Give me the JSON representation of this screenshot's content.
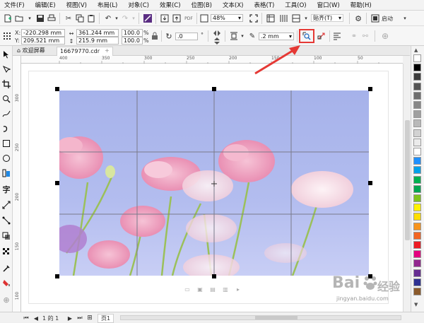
{
  "menu": [
    "文件(F)",
    "编辑(E)",
    "视图(V)",
    "布局(L)",
    "对象(C)",
    "效果(C)",
    "位图(B)",
    "文本(X)",
    "表格(T)",
    "工具(O)",
    "窗口(W)",
    "帮助(H)"
  ],
  "toolbar": {
    "zoom_value": "48%",
    "snap_label": "贴齐(T)",
    "launch_label": "启动"
  },
  "properties": {
    "x_label": "X:",
    "y_label": "Y:",
    "x_value": "-220.298 mm",
    "y_value": "209.521 mm",
    "width_value": "361.244 mm",
    "height_value": "215.9 mm",
    "scale_x": "100.0",
    "scale_y": "100.0",
    "percent": "%",
    "rotation_value": ".0",
    "degree": "°",
    "outline_value": ".2 mm"
  },
  "tabs": {
    "welcome": "欢迎屏幕",
    "document": "16679770.cdr",
    "add": "+"
  },
  "ruler": {
    "top": [
      "400",
      "350",
      "300",
      "250",
      "200",
      "150",
      "100",
      "50"
    ],
    "left": [
      "300",
      "250",
      "200",
      "150",
      "100"
    ]
  },
  "status": {
    "page_info": "1 的 1",
    "page_tab": "页1"
  },
  "watermark": {
    "brand": "Bai",
    "brand2": "经验",
    "url": "jingyan.baidu.com"
  },
  "palette": [
    "#ffffff",
    "#000000",
    "#3c3c3c",
    "#555555",
    "#6e6e6e",
    "#878787",
    "#a0a0a0",
    "#b9b9b9",
    "#d2d2d2",
    "#ebebeb",
    "#ffffff",
    "#1e90ff",
    "#00a0e9",
    "#00b050",
    "#00a651",
    "#7fc31c",
    "#fff200",
    "#ffde00",
    "#f7941d",
    "#f26522",
    "#ed1c24",
    "#e4007f",
    "#92278f",
    "#662d91",
    "#2e3192",
    "#8b5a2b"
  ],
  "colors": {
    "highlight": "#e53935",
    "sky": "#a9b5ec"
  }
}
